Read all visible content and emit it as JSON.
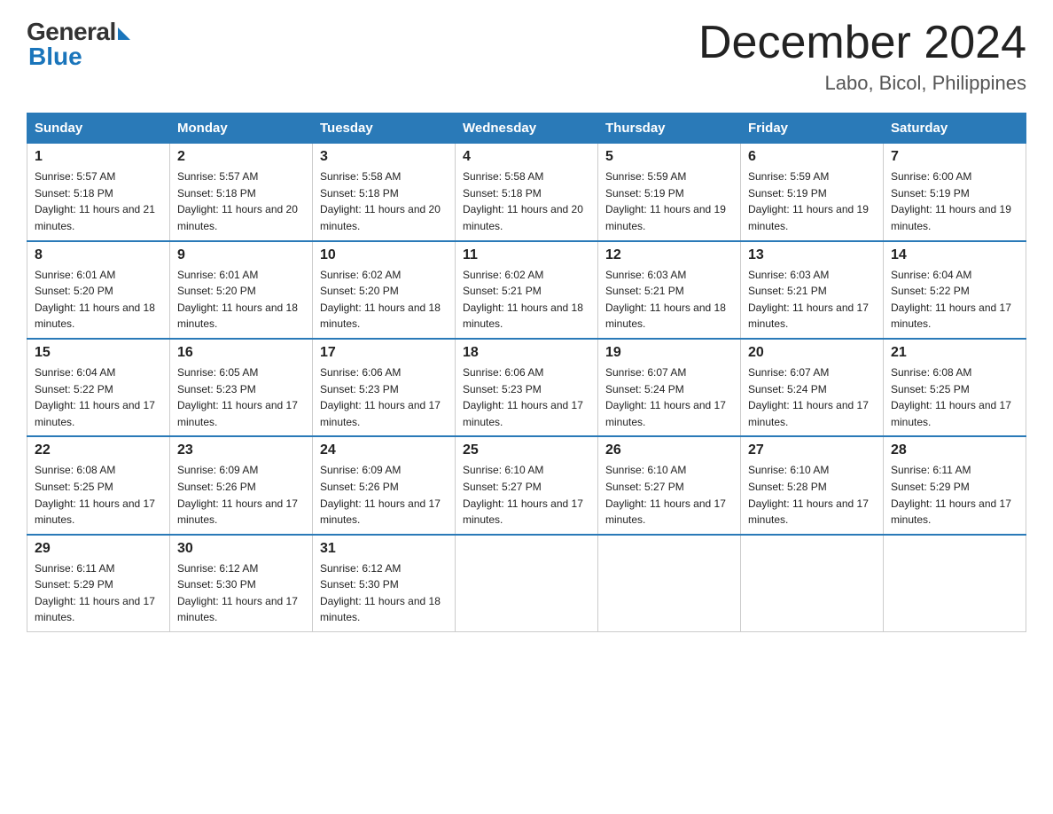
{
  "header": {
    "logo_general": "General",
    "logo_blue": "Blue",
    "month_title": "December 2024",
    "location": "Labo, Bicol, Philippines"
  },
  "days_of_week": [
    "Sunday",
    "Monday",
    "Tuesday",
    "Wednesday",
    "Thursday",
    "Friday",
    "Saturday"
  ],
  "weeks": [
    [
      {
        "day": "1",
        "sunrise": "5:57 AM",
        "sunset": "5:18 PM",
        "daylight": "11 hours and 21 minutes."
      },
      {
        "day": "2",
        "sunrise": "5:57 AM",
        "sunset": "5:18 PM",
        "daylight": "11 hours and 20 minutes."
      },
      {
        "day": "3",
        "sunrise": "5:58 AM",
        "sunset": "5:18 PM",
        "daylight": "11 hours and 20 minutes."
      },
      {
        "day": "4",
        "sunrise": "5:58 AM",
        "sunset": "5:18 PM",
        "daylight": "11 hours and 20 minutes."
      },
      {
        "day": "5",
        "sunrise": "5:59 AM",
        "sunset": "5:19 PM",
        "daylight": "11 hours and 19 minutes."
      },
      {
        "day": "6",
        "sunrise": "5:59 AM",
        "sunset": "5:19 PM",
        "daylight": "11 hours and 19 minutes."
      },
      {
        "day": "7",
        "sunrise": "6:00 AM",
        "sunset": "5:19 PM",
        "daylight": "11 hours and 19 minutes."
      }
    ],
    [
      {
        "day": "8",
        "sunrise": "6:01 AM",
        "sunset": "5:20 PM",
        "daylight": "11 hours and 18 minutes."
      },
      {
        "day": "9",
        "sunrise": "6:01 AM",
        "sunset": "5:20 PM",
        "daylight": "11 hours and 18 minutes."
      },
      {
        "day": "10",
        "sunrise": "6:02 AM",
        "sunset": "5:20 PM",
        "daylight": "11 hours and 18 minutes."
      },
      {
        "day": "11",
        "sunrise": "6:02 AM",
        "sunset": "5:21 PM",
        "daylight": "11 hours and 18 minutes."
      },
      {
        "day": "12",
        "sunrise": "6:03 AM",
        "sunset": "5:21 PM",
        "daylight": "11 hours and 18 minutes."
      },
      {
        "day": "13",
        "sunrise": "6:03 AM",
        "sunset": "5:21 PM",
        "daylight": "11 hours and 17 minutes."
      },
      {
        "day": "14",
        "sunrise": "6:04 AM",
        "sunset": "5:22 PM",
        "daylight": "11 hours and 17 minutes."
      }
    ],
    [
      {
        "day": "15",
        "sunrise": "6:04 AM",
        "sunset": "5:22 PM",
        "daylight": "11 hours and 17 minutes."
      },
      {
        "day": "16",
        "sunrise": "6:05 AM",
        "sunset": "5:23 PM",
        "daylight": "11 hours and 17 minutes."
      },
      {
        "day": "17",
        "sunrise": "6:06 AM",
        "sunset": "5:23 PM",
        "daylight": "11 hours and 17 minutes."
      },
      {
        "day": "18",
        "sunrise": "6:06 AM",
        "sunset": "5:23 PM",
        "daylight": "11 hours and 17 minutes."
      },
      {
        "day": "19",
        "sunrise": "6:07 AM",
        "sunset": "5:24 PM",
        "daylight": "11 hours and 17 minutes."
      },
      {
        "day": "20",
        "sunrise": "6:07 AM",
        "sunset": "5:24 PM",
        "daylight": "11 hours and 17 minutes."
      },
      {
        "day": "21",
        "sunrise": "6:08 AM",
        "sunset": "5:25 PM",
        "daylight": "11 hours and 17 minutes."
      }
    ],
    [
      {
        "day": "22",
        "sunrise": "6:08 AM",
        "sunset": "5:25 PM",
        "daylight": "11 hours and 17 minutes."
      },
      {
        "day": "23",
        "sunrise": "6:09 AM",
        "sunset": "5:26 PM",
        "daylight": "11 hours and 17 minutes."
      },
      {
        "day": "24",
        "sunrise": "6:09 AM",
        "sunset": "5:26 PM",
        "daylight": "11 hours and 17 minutes."
      },
      {
        "day": "25",
        "sunrise": "6:10 AM",
        "sunset": "5:27 PM",
        "daylight": "11 hours and 17 minutes."
      },
      {
        "day": "26",
        "sunrise": "6:10 AM",
        "sunset": "5:27 PM",
        "daylight": "11 hours and 17 minutes."
      },
      {
        "day": "27",
        "sunrise": "6:10 AM",
        "sunset": "5:28 PM",
        "daylight": "11 hours and 17 minutes."
      },
      {
        "day": "28",
        "sunrise": "6:11 AM",
        "sunset": "5:29 PM",
        "daylight": "11 hours and 17 minutes."
      }
    ],
    [
      {
        "day": "29",
        "sunrise": "6:11 AM",
        "sunset": "5:29 PM",
        "daylight": "11 hours and 17 minutes."
      },
      {
        "day": "30",
        "sunrise": "6:12 AM",
        "sunset": "5:30 PM",
        "daylight": "11 hours and 17 minutes."
      },
      {
        "day": "31",
        "sunrise": "6:12 AM",
        "sunset": "5:30 PM",
        "daylight": "11 hours and 18 minutes."
      },
      null,
      null,
      null,
      null
    ]
  ]
}
